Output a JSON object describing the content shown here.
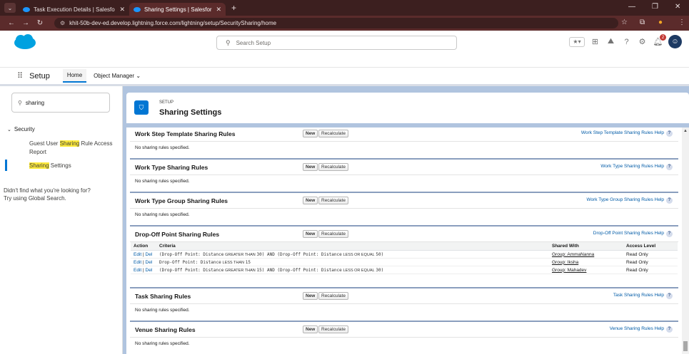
{
  "browser": {
    "tabs": [
      {
        "title": "Task Execution Details | Salesfo",
        "active": false
      },
      {
        "title": "Sharing Settings | Salesforce",
        "active": true
      }
    ],
    "url": "khit-50b-dev-ed.develop.lightning.force.com/lightning/setup/SecuritySharing/home"
  },
  "header": {
    "search_placeholder": "Search Setup",
    "notification_count": "2"
  },
  "context": {
    "app_name": "Setup",
    "tabs": [
      "Home",
      "Object Manager"
    ]
  },
  "sidebar": {
    "quick_find_value": "sharing",
    "group": "Security",
    "items": [
      {
        "before": "Guest User ",
        "highlight": "Sharing",
        "after": " Rule Access Report"
      },
      {
        "before": "",
        "highlight": "Sharing",
        "after": " Settings"
      }
    ],
    "not_found_line1": "Didn't find what you're looking for?",
    "not_found_line2": "Try using Global Search."
  },
  "page": {
    "eyebrow": "SETUP",
    "title": "Sharing Settings"
  },
  "buttons": {
    "new": "New",
    "recalculate": "Recalculate"
  },
  "empty_text": "No sharing rules specified.",
  "sections": {
    "work_step": {
      "title": "Work Step Template Sharing Rules",
      "help": "Work Step Template Sharing Rules Help"
    },
    "work_type": {
      "title": "Work Type Sharing Rules",
      "help": "Work Type Sharing Rules Help"
    },
    "work_type_group": {
      "title": "Work Type Group Sharing Rules",
      "help": "Work Type Group Sharing Rules Help"
    },
    "drop_off": {
      "title": "Drop-Off Point Sharing Rules",
      "help": "Drop-Off Point Sharing Rules Help",
      "columns": [
        "Action",
        "Criteria",
        "Shared With",
        "Access Level"
      ],
      "action_edit": "Edit",
      "action_sep": " | ",
      "action_del": "Del",
      "rows": [
        {
          "c1": "(Drop-Off Point: Distance",
          "o1": "GREATER THAN",
          "c2": "30) AND (Drop-Off Point: Distance",
          "o2": "LESS OR EQUAL",
          "c3": "50)",
          "shared": "Group: AmmaNanna",
          "access": "Read Only"
        },
        {
          "c1": "Drop-Off Point: Distance",
          "o1": "LESS THAN",
          "c2": "15",
          "o2": "",
          "c3": "",
          "shared": "Group: Iksha",
          "access": "Read Only"
        },
        {
          "c1": "(Drop-Off Point: Distance",
          "o1": "GREATER THAN",
          "c2": "15) AND (Drop-Off Point: Distance",
          "o2": "LESS OR EQUAL",
          "c3": "30)",
          "shared": "Group: Mahadev",
          "access": "Read Only"
        }
      ]
    },
    "task": {
      "title": "Task Sharing Rules",
      "help": "Task Sharing Rules Help"
    },
    "venue": {
      "title": "Venue Sharing Rules",
      "help": "Venue Sharing Rules Help"
    }
  }
}
